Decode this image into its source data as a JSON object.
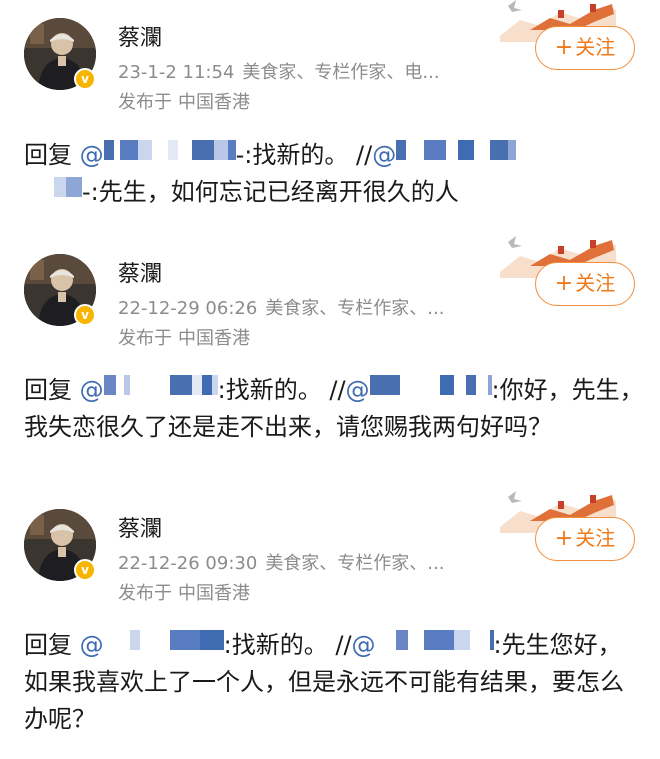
{
  "posts": [
    {
      "username": "蔡瀾",
      "time": "23-1-2 11:54",
      "tags": "美食家、专栏作家、电...",
      "location_prefix": "发布于",
      "location": "中国香港",
      "follow_label": "关注",
      "follow_plus": "+",
      "reply_prefix": "回复",
      "mention_at": "@",
      "reply_text": "-:找新的。",
      "forward_marker": "//",
      "forward_at": "@",
      "original_text": "-:先生，如何忘记已经离开很久的人"
    },
    {
      "username": "蔡瀾",
      "time": "22-12-29 06:26",
      "tags": "美食家、专栏作家、...",
      "location_prefix": "发布于",
      "location": "中国香港",
      "follow_label": "关注",
      "follow_plus": "+",
      "reply_prefix": "回复",
      "mention_at": "@",
      "reply_text": ":找新的。",
      "forward_marker": "//",
      "forward_at": "@",
      "original_text": ":你好，先生，我失恋很久了还是走不出来，请您赐我两句好吗？"
    },
    {
      "username": "蔡瀾",
      "time": "22-12-26 09:30",
      "tags": "美食家、专栏作家、...",
      "location_prefix": "发布于",
      "location": "中国香港",
      "follow_label": "关注",
      "follow_plus": "+",
      "reply_prefix": "回复",
      "mention_at": "@",
      "reply_text": ":找新的。",
      "forward_marker": "//",
      "forward_at": "@",
      "original_text": ":先生您好，如果我喜欢上了一个人，但是永远不可能有结果，要怎么办呢？"
    }
  ],
  "colors": {
    "mention": "#3f6bb3",
    "follow_accent": "#f07a1a",
    "meta_gray": "#8c8c8c",
    "verified_badge": "#f7b500"
  },
  "icons": {
    "verified": "verified-badge-icon",
    "decor": "great-wall-decoration-icon",
    "avatar": "user-avatar"
  }
}
